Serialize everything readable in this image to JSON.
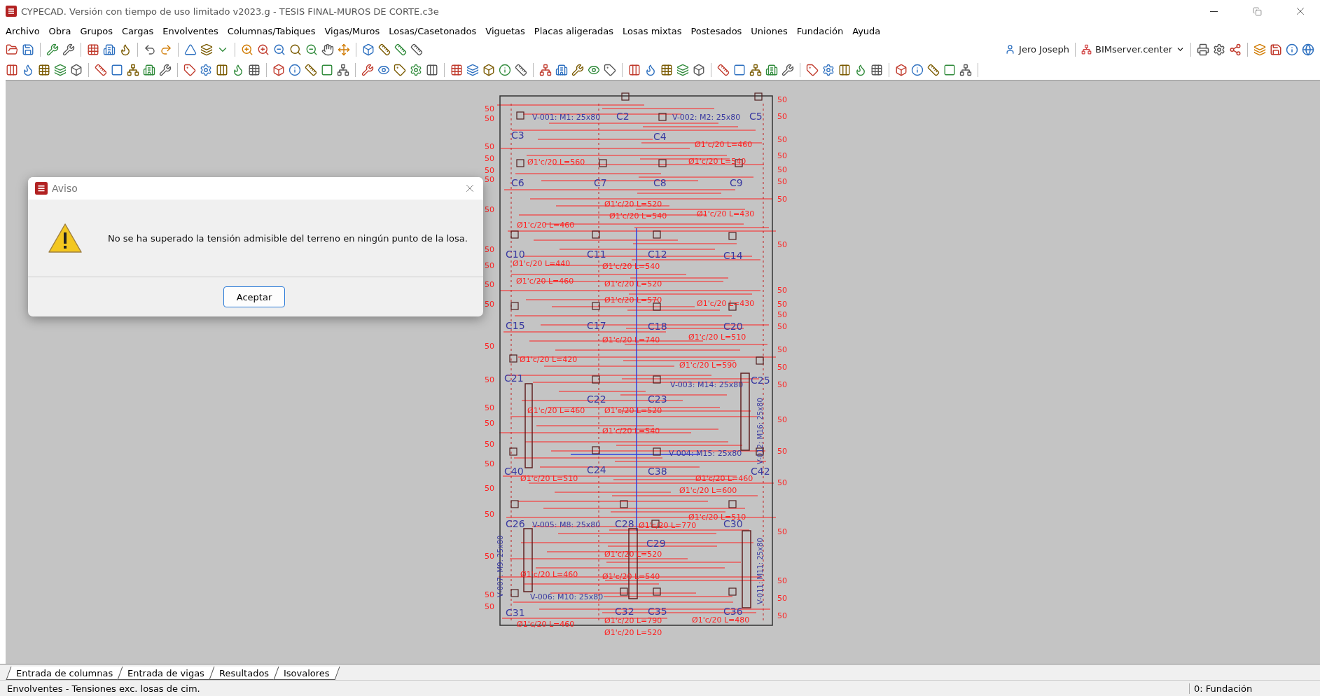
{
  "window": {
    "title": "CYPECAD. Versión con tiempo de uso limitado v2023.g - TESIS FINAL-MUROS DE CORTE.c3e"
  },
  "menu": [
    "Archivo",
    "Obra",
    "Grupos",
    "Cargas",
    "Envolventes",
    "Columnas/Tabiques",
    "Vigas/Muros",
    "Losas/Casetonados",
    "Viguetas",
    "Placas aligeradas",
    "Losas mixtas",
    "Postesados",
    "Uniones",
    "Fundación",
    "Ayuda"
  ],
  "toolbar": {
    "user": "Jero Joseph",
    "server": "BIMserver.center"
  },
  "drawing": {
    "columns": [
      "C2",
      "C3",
      "C4",
      "C5",
      "C6",
      "C7",
      "C8",
      "C9",
      "C10",
      "C11",
      "C12",
      "C14",
      "C15",
      "C17",
      "C18",
      "C20",
      "C21",
      "C22",
      "C23",
      "C25",
      "C40",
      "C24",
      "C38",
      "C42",
      "C26",
      "C28",
      "C29",
      "C30",
      "C31",
      "C32",
      "C35",
      "C36"
    ],
    "beams": [
      "V-001: M1: 25x80",
      "V-002: M2: 25x80",
      "V-003: M14: 25x80",
      "V-004: M15: 25x80",
      "V-005: M8: 25x80",
      "V-006: M10: 25x80"
    ],
    "vertical_beams": [
      "V-012: M16: 25x80",
      "V-011: M11: 25x80",
      "V-007: M9: 25x80"
    ],
    "rebars": [
      "Ø1'c/20 L=460",
      "Ø1'c/20 L=560",
      "Ø1'c/20 L=540",
      "Ø1'c/20 L=520",
      "Ø1'c/20 L=540",
      "Ø1'c/20 L=430",
      "Ø1'c/20 L=460",
      "Ø1'c/20 L=440",
      "Ø1'c/20 L=540",
      "Ø1'c/20 L=460",
      "Ø1'c/20 L=520",
      "Ø1'c/20 L=570",
      "Ø1'c/20 L=430",
      "Ø1'c/20 L=510",
      "Ø1'c/20 L=740",
      "Ø1'c/20 L=420",
      "Ø1'c/20 L=590",
      "Ø1'c/20 L=460",
      "Ø1'c/20 L=520",
      "Ø1'c/20 L=540",
      "Ø1'c/20 L=510",
      "Ø1'c/20 L=460",
      "Ø1'c/20 L=600",
      "Ø1'c/20 L=510",
      "Ø1'c/20 L=770",
      "Ø1'c/20 L=520",
      "Ø1'c/20 L=460",
      "Ø1'c/20 L=540",
      "Ø1'c/20 L=790",
      "Ø1'c/20 L=480",
      "Ø1'c/20 L=460",
      "Ø1'c/20 L=520"
    ],
    "left_marks": [
      "50",
      "50",
      "50",
      "50",
      "50",
      "50",
      "50",
      "50",
      "50",
      "50",
      "50",
      "50",
      "50",
      "50",
      "50",
      "50",
      "50",
      "50",
      "50",
      "50",
      "50",
      "50"
    ],
    "right_marks": [
      "50",
      "50",
      "50",
      "50",
      "50",
      "50",
      "50",
      "50",
      "50",
      "50",
      "50",
      "50",
      "50",
      "50",
      "50",
      "50",
      "50",
      "50",
      "50",
      "50",
      "50",
      "50"
    ]
  },
  "dialog": {
    "title": "Aviso",
    "message": "No se ha superado la tensión admisible del terreno en ningún punto de la losa.",
    "button": "Aceptar"
  },
  "tabs": [
    "Entrada de columnas",
    "Entrada de vigas",
    "Resultados",
    "Isovalores"
  ],
  "status_bar": {
    "text": "Envolventes - Tensiones exc. losas de cim.",
    "group": "0: Fundación"
  }
}
